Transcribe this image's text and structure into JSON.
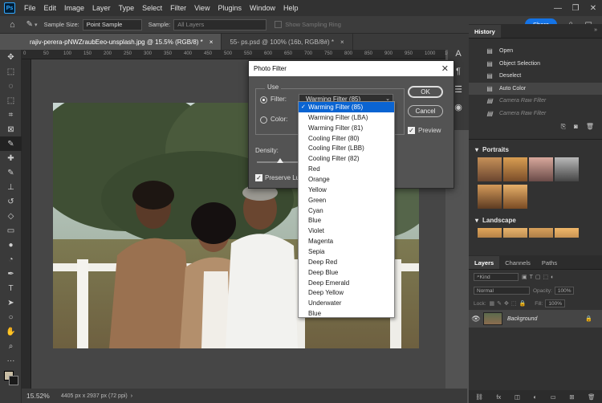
{
  "menu": [
    "File",
    "Edit",
    "Image",
    "Layer",
    "Type",
    "Select",
    "Filter",
    "View",
    "Plugins",
    "Window",
    "Help"
  ],
  "options": {
    "sample_size_label": "Sample Size:",
    "sample_size_value": "Point Sample",
    "sample_label": "Sample:",
    "sample_value": "All Layers",
    "show_ring_label": "Show Sampling Ring",
    "share_label": "Share"
  },
  "tabs": [
    {
      "label": "rajiv-perera-pNWZraubEeo-unsplash.jpg @ 15.5% (RGB/8) *"
    },
    {
      "label": "55- ps.psd @ 100% (16b, RGB/8#) *"
    }
  ],
  "ruler": [
    "0",
    "50",
    "100",
    "150",
    "200",
    "250",
    "300",
    "350",
    "400",
    "450",
    "500",
    "550",
    "600",
    "650",
    "700",
    "750",
    "800",
    "850",
    "900",
    "950",
    "1000",
    "1050"
  ],
  "status": {
    "zoom": "15.52%",
    "doc_info": "4405 px x 2937 px (72 ppi)"
  },
  "dialog": {
    "title": "Photo Filter",
    "use_label": "Use",
    "filter_label": "Filter:",
    "filter_value": "Warming Filter (85)",
    "color_label": "Color:",
    "density_label": "Density:",
    "preserve_label": "Preserve Lu",
    "ok_label": "OK",
    "cancel_label": "Cancel",
    "preview_label": "Preview"
  },
  "filter_options": [
    "Warming Filter (85)",
    "Warming Filter (LBA)",
    "Warming Filter (81)",
    "Cooling Filter (80)",
    "Cooling Filter (LBB)",
    "Cooling Filter (82)",
    "Red",
    "Orange",
    "Yellow",
    "Green",
    "Cyan",
    "Blue",
    "Violet",
    "Magenta",
    "Sepia",
    "Deep Red",
    "Deep Blue",
    "Deep Emerald",
    "Deep Yellow",
    "Underwater",
    "Blue"
  ],
  "history": {
    "tab": "History",
    "items": [
      {
        "label": "Open",
        "state": "done"
      },
      {
        "label": "Object Selection",
        "state": "done"
      },
      {
        "label": "Deselect",
        "state": "done"
      },
      {
        "label": "Auto Color",
        "state": "selected"
      },
      {
        "label": "Camera Raw Filter",
        "state": "undone"
      },
      {
        "label": "Camera Raw Filter",
        "state": "undone"
      }
    ]
  },
  "presets": {
    "portraits": "Portraits",
    "landscape": "Landscape"
  },
  "layers": {
    "tabs": [
      "Layers",
      "Channels",
      "Paths"
    ],
    "kind": "Kind",
    "blend": "Normal",
    "opacity_label": "Opacity:",
    "opacity_value": "100%",
    "lock_label": "Lock:",
    "fill_label": "Fill:",
    "fill_value": "100%",
    "layer_name": "Background"
  },
  "colors": {
    "accent": "#1473e6",
    "selection": "#0a64d2"
  }
}
